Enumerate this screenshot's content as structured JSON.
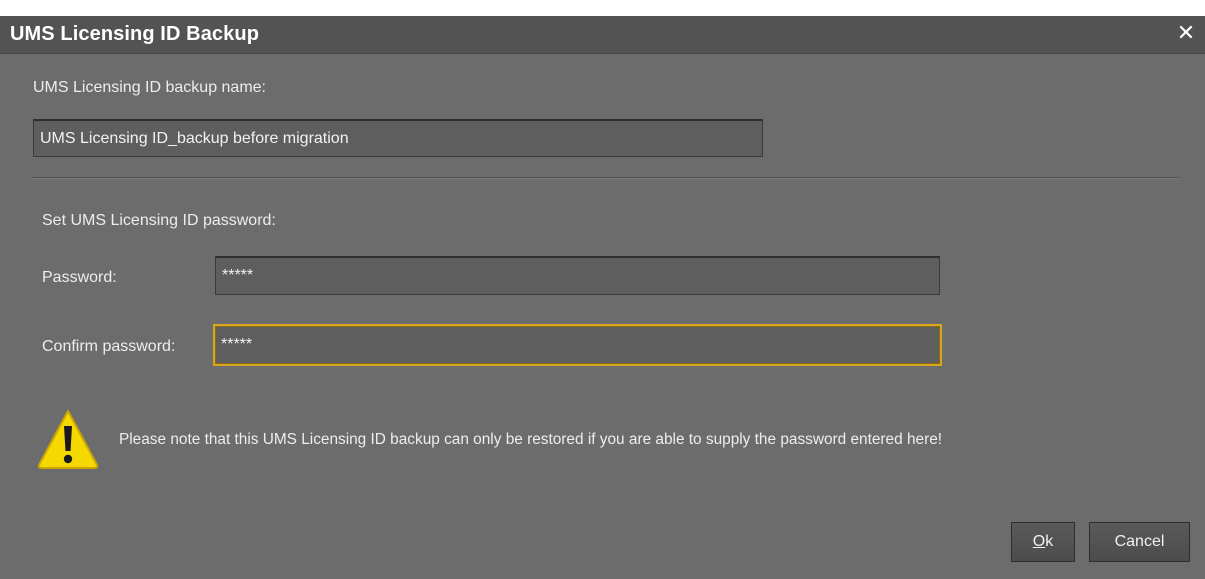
{
  "dialog": {
    "title": "UMS Licensing ID Backup",
    "close_glyph": "✕"
  },
  "backup_name": {
    "label": "UMS Licensing ID backup name:",
    "value": "UMS Licensing ID_backup before migration"
  },
  "password_section": {
    "heading": "Set UMS Licensing ID password:",
    "password_label": "Password:",
    "password_value": "*****",
    "confirm_label": "Confirm password:",
    "confirm_value": "*****"
  },
  "warning": {
    "icon": "warning-triangle-icon",
    "text": "Please note that this UMS Licensing ID backup can only be restored if you are able to supply the password entered here!"
  },
  "buttons": {
    "ok_mnemonic": "O",
    "ok_rest": "k",
    "cancel": "Cancel"
  },
  "colors": {
    "dialog_bg": "#6c6c6c",
    "titlebar_bg": "#535353",
    "focus_border": "#d9a51c",
    "warning_yellow": "#f5d800"
  }
}
